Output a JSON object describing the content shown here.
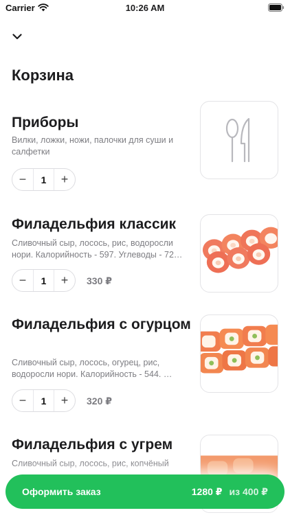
{
  "status_bar": {
    "carrier": "Carrier",
    "time": "10:26 AM"
  },
  "header": {
    "close_icon": "chevron-down-icon",
    "title": "Корзина"
  },
  "cart": {
    "items": [
      {
        "name": "Приборы",
        "description": "Вилки, ложки, ножи, палочки для суши и салфетки",
        "quantity": "1",
        "price": "",
        "image": "cutlery-icon"
      },
      {
        "name": "Филадельфия классик",
        "description": "Сливочный сыр, лосось, рис, водоросли нори. Калорийность - 597. Углеводы - 72…",
        "quantity": "1",
        "price": "330 ₽",
        "image": "sushi-roll-photo"
      },
      {
        "name": "Филадельфия с огурцом",
        "description": "Сливочный сыр, лосось, огурец, рис, водоросли нори. Калорийность - 544. …",
        "quantity": "1",
        "price": "320 ₽",
        "image": "sushi-roll-photo"
      },
      {
        "name": "Филадельфия с угрем",
        "description": "Сливочный сыр, лосось, рис, копчёный",
        "quantity": "",
        "price": "",
        "image": "sushi-roll-photo"
      }
    ],
    "stepper": {
      "minus": "−",
      "plus": "+"
    }
  },
  "checkout": {
    "label": "Оформить заказ",
    "total": "1280 ₽",
    "minimum": "из 400 ₽",
    "color": "#22c05b"
  }
}
